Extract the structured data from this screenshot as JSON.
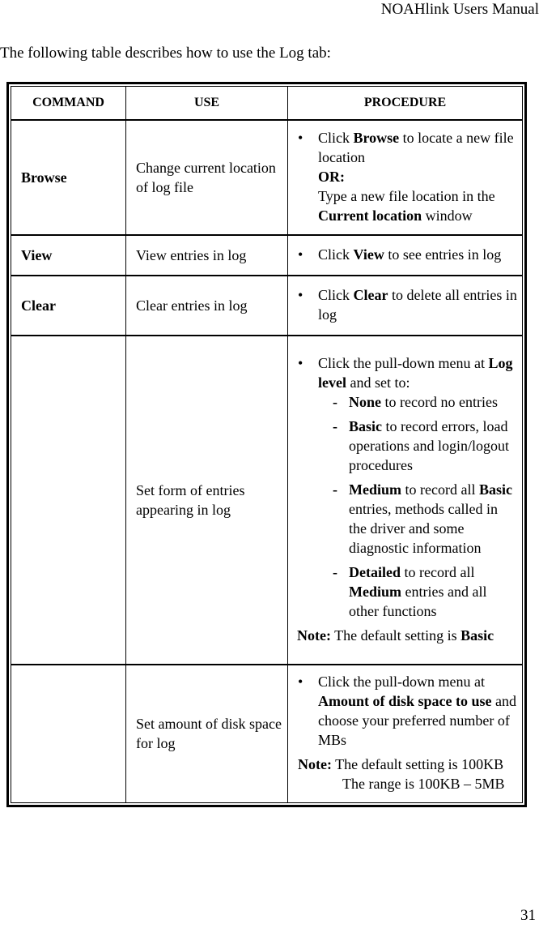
{
  "page": {
    "header_title": "NOAHlink Users Manual",
    "intro": "The following table describes how to use the Log tab:",
    "page_number": "31"
  },
  "table": {
    "headers": [
      "COMMAND",
      "USE",
      "PROCEDURE"
    ],
    "rows": [
      {
        "command": "Browse",
        "use": "Change current location of log file",
        "procedure": {
          "bullet_pre": "Click ",
          "bullet_bold": "Browse",
          "bullet_post": " to locate a new file location",
          "or_label": "OR:",
          "alt_pre": "Type a new file location in the ",
          "alt_bold": "Current location",
          "alt_post": " window"
        }
      },
      {
        "command": "View",
        "use": "View entries in log",
        "procedure": {
          "bullet_pre": "Click ",
          "bullet_bold": "View",
          "bullet_post": " to see entries in log"
        }
      },
      {
        "command": "Clear",
        "use": "Clear entries in log",
        "procedure": {
          "bullet_pre": "Click ",
          "bullet_bold": "Clear",
          "bullet_post": " to delete all entries in log"
        }
      },
      {
        "command": "",
        "use": "Set form of entries appearing in log",
        "procedure": {
          "bullet_pre": "Click the pull-down menu at ",
          "bullet_bold": "Log level",
          "bullet_post": " and set to:",
          "options": [
            {
              "bold": "None",
              "text": " to record no entries"
            },
            {
              "bold": "Basic",
              "text": " to record errors, load operations and login/logout procedures"
            },
            {
              "bold": "Medium",
              "text": " to record all ",
              "bold2": "Basic",
              "text2": " entries, methods called in the driver and some diagnostic information"
            },
            {
              "bold": "Detailed",
              "text": " to record all ",
              "bold2": "Medium",
              "text2": " entries and all other functions"
            }
          ],
          "note_label": "Note:",
          "note_pre": " The default setting is ",
          "note_bold": "Basic"
        }
      },
      {
        "command": "",
        "use": "Set amount of disk space for log",
        "procedure": {
          "bullet_pre": "Click the pull-down menu at ",
          "bullet_bold": "Amount of disk space to use",
          "bullet_post": " and choose your preferred number of MBs",
          "note_label": "Note:",
          "note_line1": " The default setting is 100KB",
          "note_line2": "The range is 100KB – 5MB"
        }
      }
    ]
  }
}
